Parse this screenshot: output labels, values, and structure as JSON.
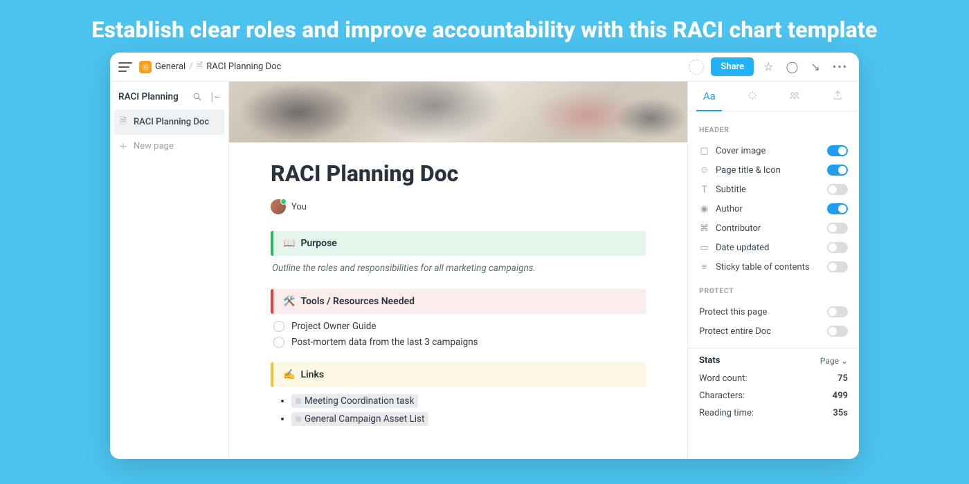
{
  "hero": "Establish clear roles and improve accountability with this RACI chart template",
  "breadcrumb": {
    "space": "General",
    "doc": "RACI Planning Doc"
  },
  "topbar": {
    "share": "Share"
  },
  "sidebar": {
    "title": "RACI Planning",
    "items": [
      {
        "label": "RACI Planning Doc",
        "active": true
      },
      {
        "label": "New page",
        "active": false
      }
    ]
  },
  "document": {
    "title": "RACI Planning Doc",
    "author": "You",
    "purpose": {
      "heading": "Purpose",
      "body": "Outline the roles and responsibilities for all marketing campaigns."
    },
    "tools": {
      "heading": "Tools / Resources Needed",
      "items": [
        "Project Owner Guide",
        "Post-mortem data from the last 3 campaigns"
      ]
    },
    "links": {
      "heading": "Links",
      "items": [
        "Meeting Coordination task",
        "General Campaign Asset List"
      ]
    }
  },
  "inspector": {
    "tab_text": "Aa",
    "header_label": "HEADER",
    "header_rows": [
      {
        "label": "Cover image",
        "on": true
      },
      {
        "label": "Page title & Icon",
        "on": true
      },
      {
        "label": "Subtitle",
        "on": false
      },
      {
        "label": "Author",
        "on": true
      },
      {
        "label": "Contributor",
        "on": false
      },
      {
        "label": "Date updated",
        "on": false
      },
      {
        "label": "Sticky table of contents",
        "on": false
      }
    ],
    "protect_label": "PROTECT",
    "protect_rows": [
      {
        "label": "Protect this page",
        "on": false
      },
      {
        "label": "Protect entire Doc",
        "on": false
      }
    ],
    "stats": {
      "title": "Stats",
      "scope": "Page",
      "rows": [
        {
          "label": "Word count:",
          "value": "75"
        },
        {
          "label": "Characters:",
          "value": "499"
        },
        {
          "label": "Reading time:",
          "value": "35s"
        }
      ]
    }
  }
}
